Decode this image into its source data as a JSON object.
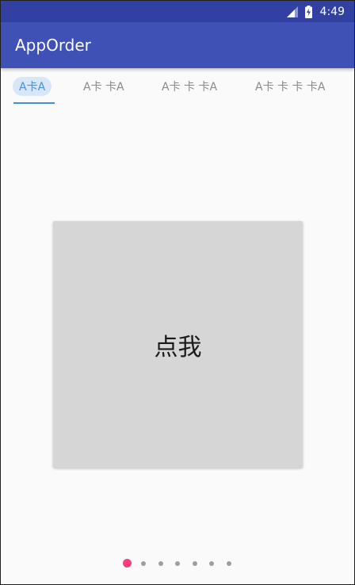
{
  "status_bar": {
    "time": "4:49",
    "battery_level_text": "",
    "icons": [
      "signal-icon",
      "battery-charging-icon"
    ]
  },
  "app_bar": {
    "title": "AppOrder"
  },
  "tabs": [
    {
      "label": "A卡A",
      "selected": true
    },
    {
      "label": "A卡 卡A",
      "selected": false
    },
    {
      "label": "A卡 卡 卡A",
      "selected": false
    },
    {
      "label": "A卡 卡 卡 卡A",
      "selected": false
    }
  ],
  "card": {
    "label": "点我"
  },
  "pager": {
    "count": 7,
    "current": 1
  },
  "colors": {
    "status_bar": "#3241a1",
    "app_bar": "#3f51b5",
    "tab_active_text": "#4a8fd8",
    "tab_active_bg": "#d7e6f9",
    "tab_indicator": "#3d8fe0",
    "card_bg": "#d6d6d6",
    "dot_active": "#ff3c7e",
    "dot_inactive": "#9e9e9e"
  }
}
